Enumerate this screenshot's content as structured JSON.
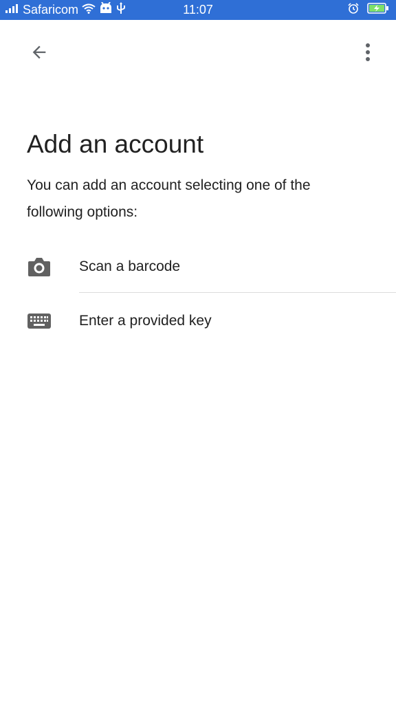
{
  "status_bar": {
    "carrier": "Safaricom",
    "time": "11:07",
    "icons": [
      "signal-icon",
      "wifi-icon",
      "android-icon",
      "usb-icon",
      "alarm-icon",
      "battery-charging-icon"
    ],
    "background_color": "#2f6fd6"
  },
  "app_bar": {
    "back_icon": "arrow-left-icon",
    "menu_icon": "more-vert-icon"
  },
  "main": {
    "title": "Add an account",
    "description": "You can add an account selecting one of the following options:",
    "options": [
      {
        "label": "Scan a barcode",
        "icon": "camera-icon"
      },
      {
        "label": "Enter a provided key",
        "icon": "keyboard-icon"
      }
    ]
  }
}
